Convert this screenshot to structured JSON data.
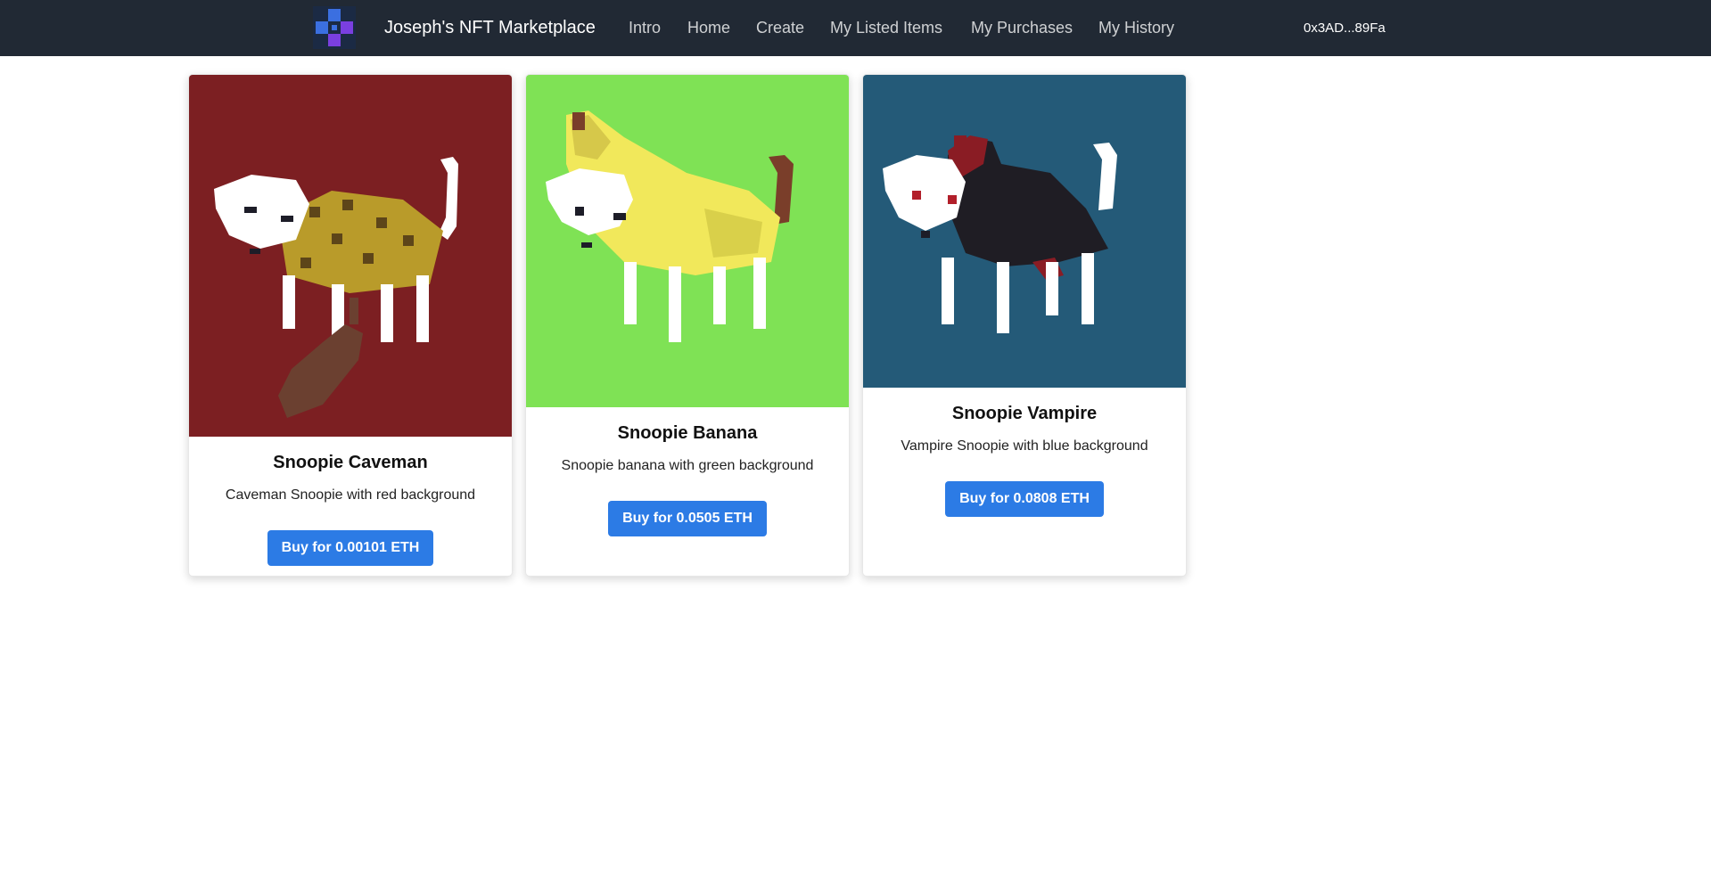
{
  "navbar": {
    "brand": "Joseph's NFT Marketplace",
    "links": [
      "Intro",
      "Home",
      "Create",
      "My Listed Items",
      "My Purchases",
      "My History"
    ],
    "wallet": "0x3AD...89Fa"
  },
  "colors": {
    "navbar_bg": "#212934",
    "button": "#2c7be5",
    "logo_blue": "#3b6fe0",
    "logo_purple": "#7a3fe0"
  },
  "items": [
    {
      "name": "Snoopie Caveman",
      "description": "Caveman Snoopie with red background",
      "button_label": "Buy for 0.00101 ETH",
      "image_bg": "#7c1f22"
    },
    {
      "name": "Snoopie Banana",
      "description": "Snoopie banana with green background",
      "button_label": "Buy for 0.0505 ETH",
      "image_bg": "#7fe255"
    },
    {
      "name": "Snoopie Vampire",
      "description": "Vampire Snoopie with blue background",
      "button_label": "Buy for 0.0808 ETH",
      "image_bg": "#245a78"
    }
  ]
}
